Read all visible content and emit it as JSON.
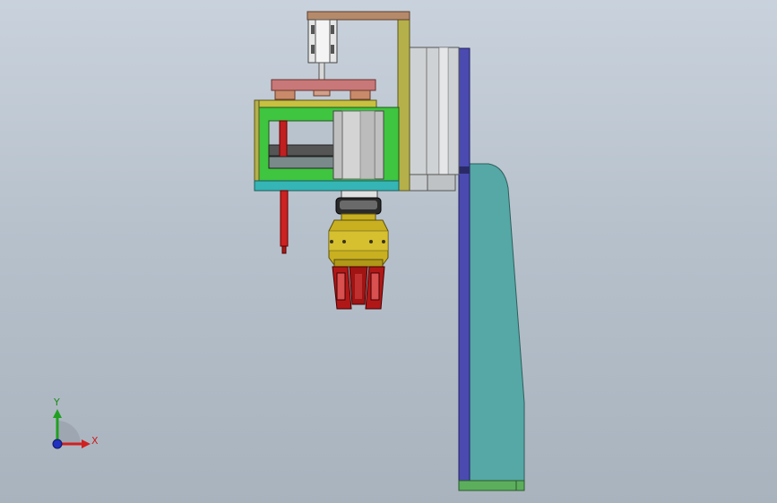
{
  "app": {
    "view": "Front",
    "background_top": "#c9d2dc",
    "background_bottom": "#a9b3be"
  },
  "triad": {
    "x_label": "X",
    "y_label": "Y",
    "x_color": "#d02020",
    "y_color": "#20a020",
    "z_color": "#2030c0"
  },
  "colors": {
    "frame_gold": "#b5b04a",
    "bracket_brown": "#b58a6a",
    "plate_red": "#c87878",
    "body_green": "#3fc53f",
    "base_teal": "#35b5b5",
    "motor_gray": "#c0c0c0",
    "rod_red": "#cc2222",
    "ring_yellow": "#c8b020",
    "gripper_red": "#b01818",
    "column_navy": "#4a4ab0",
    "arm_teal": "#55a8a5",
    "foot_green": "#5cae5c"
  }
}
